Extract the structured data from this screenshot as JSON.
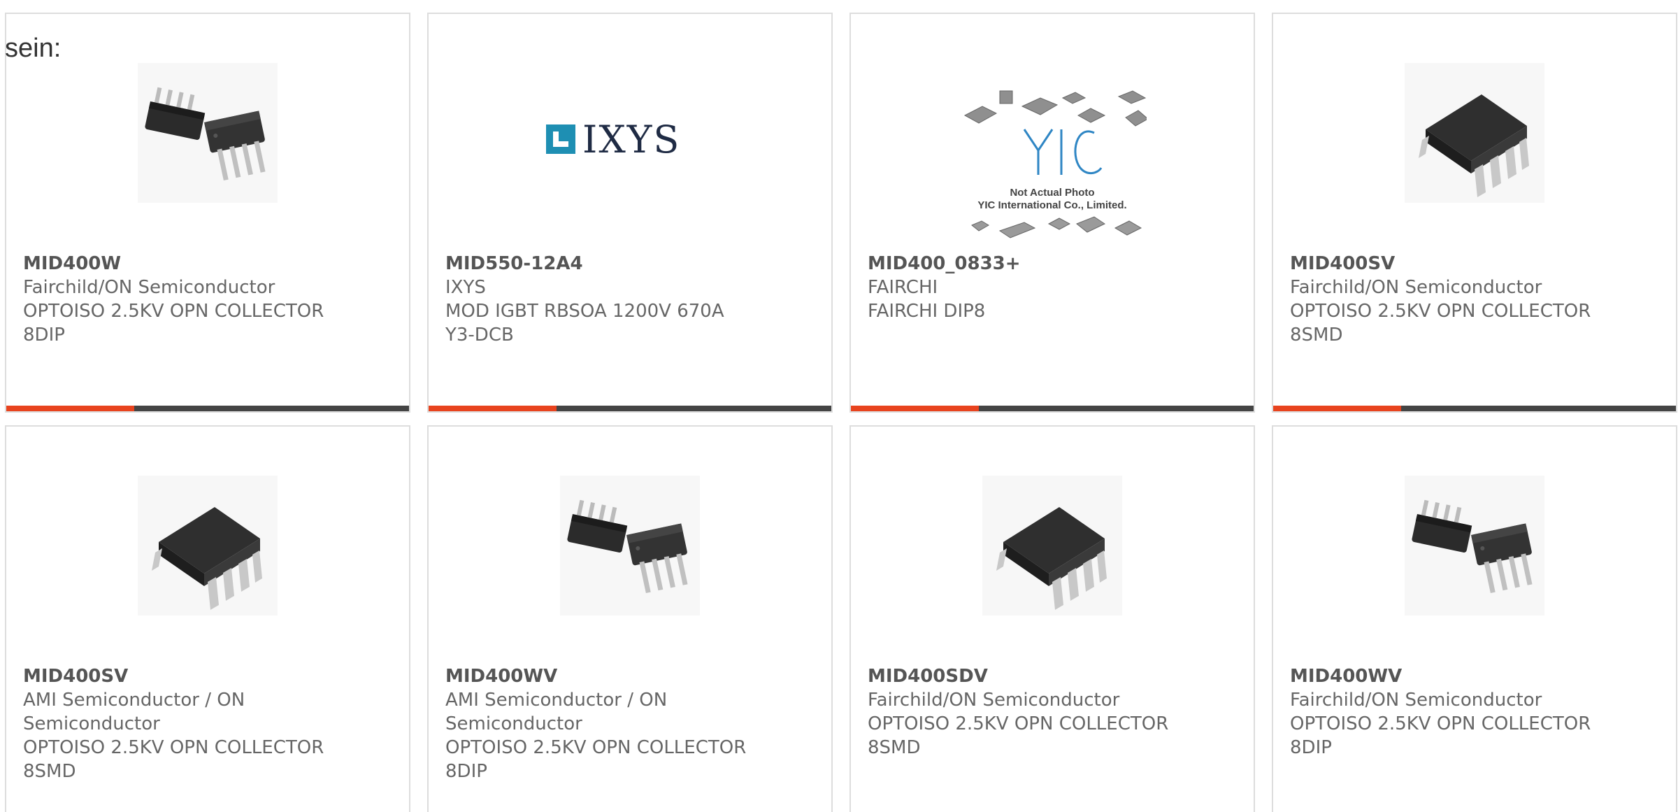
{
  "page": {
    "lead_text": "sein:"
  },
  "colors": {
    "accent": "#e8431e",
    "bar": "#444444",
    "border": "#dddddd",
    "text": "#666666"
  },
  "products": [
    {
      "part_number": "MID400W",
      "manufacturer": "Fairchild/ON Semiconductor",
      "description_1": "OPTOISO 2.5KV OPN COLLECTOR",
      "description_2": "8DIP",
      "image_icon": "dip-chip-pair-icon"
    },
    {
      "part_number": "MID550-12A4",
      "manufacturer": "IXYS",
      "description_1": "MOD IGBT RBSOA 1200V 670A",
      "description_2": "Y3-DCB",
      "image_icon": "ixys-logo",
      "logo_text": "IXYS"
    },
    {
      "part_number": "MID400_0833+",
      "manufacturer": "FAIRCHI",
      "description_1": "FAIRCHI DIP8",
      "description_2": "",
      "image_icon": "yic-placeholder-image",
      "placeholder_logo": "YIC",
      "placeholder_line_1": "Not Actual Photo",
      "placeholder_line_2": "YIC International Co., Limited."
    },
    {
      "part_number": "MID400SV",
      "manufacturer": "Fairchild/ON Semiconductor",
      "description_1": "OPTOISO 2.5KV OPN COLLECTOR",
      "description_2": "8SMD",
      "image_icon": "smd-chip-icon"
    },
    {
      "part_number": "MID400SV",
      "manufacturer": "AMI Semiconductor / ON",
      "manufacturer_2": "Semiconductor",
      "description_1": "OPTOISO 2.5KV OPN COLLECTOR",
      "description_2": "8SMD",
      "image_icon": "smd-chip-icon"
    },
    {
      "part_number": "MID400WV",
      "manufacturer": "AMI Semiconductor / ON",
      "manufacturer_2": "Semiconductor",
      "description_1": "OPTOISO 2.5KV OPN COLLECTOR",
      "description_2": "8DIP",
      "image_icon": "dip-chip-pair-icon"
    },
    {
      "part_number": "MID400SDV",
      "manufacturer": "Fairchild/ON Semiconductor",
      "description_1": "OPTOISO 2.5KV OPN COLLECTOR",
      "description_2": "8SMD",
      "image_icon": "smd-chip-icon"
    },
    {
      "part_number": "MID400WV",
      "manufacturer": "Fairchild/ON Semiconductor",
      "description_1": "OPTOISO 2.5KV OPN COLLECTOR",
      "description_2": "8DIP",
      "image_icon": "dip-chip-pair-icon"
    }
  ]
}
